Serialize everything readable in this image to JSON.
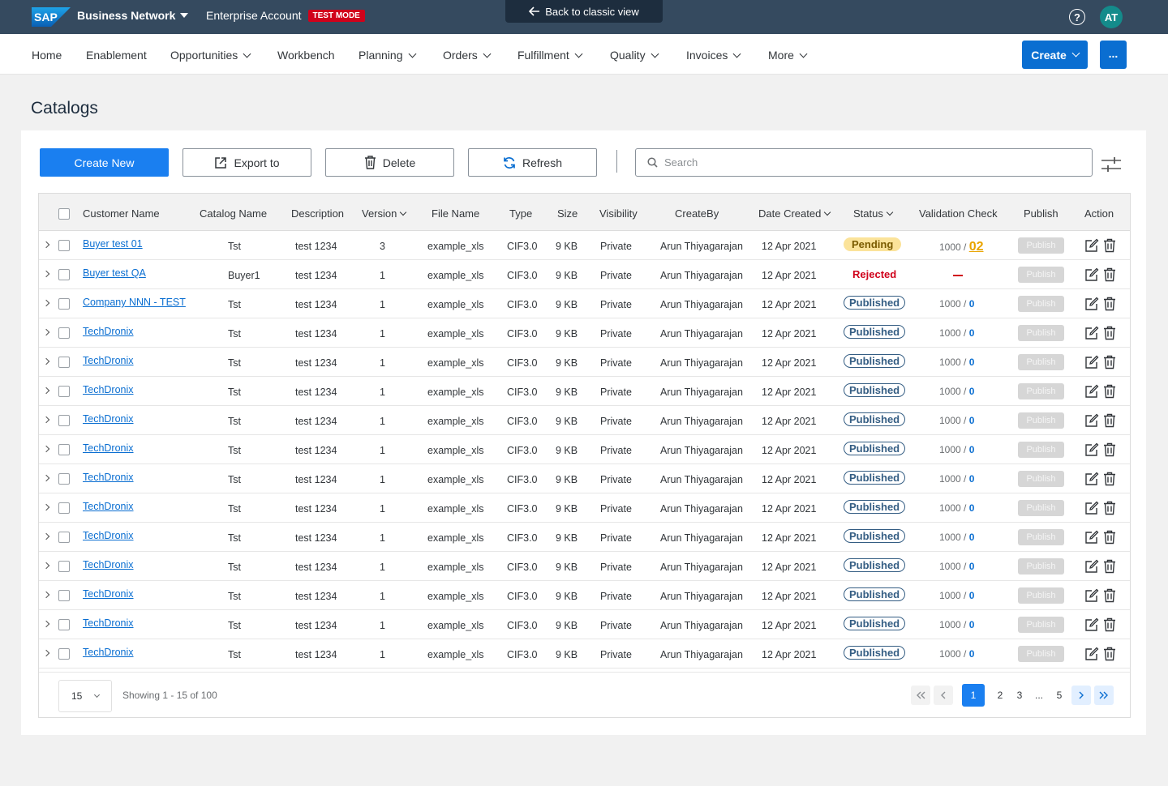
{
  "shell": {
    "logo_text": "SAP",
    "brand": "Business Network",
    "account": "Enterprise Account",
    "test_mode": "TEST MODE",
    "back_classic": "Back to classic view",
    "help": "?",
    "avatar_initials": "AT"
  },
  "nav": {
    "items": [
      {
        "label": "Home",
        "dropdown": false
      },
      {
        "label": "Enablement",
        "dropdown": false
      },
      {
        "label": "Opportunities",
        "dropdown": true
      },
      {
        "label": "Workbench",
        "dropdown": false
      },
      {
        "label": "Planning",
        "dropdown": true
      },
      {
        "label": "Orders",
        "dropdown": true
      },
      {
        "label": "Fulfillment",
        "dropdown": true
      },
      {
        "label": "Quality",
        "dropdown": true
      },
      {
        "label": "Invoices",
        "dropdown": true
      },
      {
        "label": "More",
        "dropdown": true
      }
    ],
    "create_label": "Create",
    "more_label": "..."
  },
  "page": {
    "title": "Catalogs"
  },
  "toolbar": {
    "create_new": "Create New",
    "export_to": "Export to",
    "delete": "Delete",
    "refresh": "Refresh",
    "search_placeholder": "Search"
  },
  "table": {
    "columns": {
      "customer_name": "Customer Name",
      "catalog_name": "Catalog Name",
      "description": "Description",
      "version": "Version",
      "file_name": "File Name",
      "type": "Type",
      "size": "Size",
      "visibility": "Visibility",
      "create_by": "CreateBy",
      "date_created": "Date Created",
      "status": "Status",
      "validation_check": "Validation Check",
      "publish": "Publish",
      "action": "Action"
    },
    "publish_label": "Publish",
    "rows": [
      {
        "customer": "Buyer test 01",
        "catalog": "Tst",
        "description": "test 1234",
        "version": "3",
        "file": "example_xls",
        "type": "CIF3.0",
        "size": "9 KB",
        "visibility": "Private",
        "create_by": "Arun Thiyagarajan",
        "date": "12 Apr 2021",
        "status": "Pending",
        "validation_total": "1000",
        "validation_sep": "/",
        "validation_errors": "02"
      },
      {
        "customer": "Buyer test QA",
        "catalog": "Buyer1",
        "description": "test 1234",
        "version": "1",
        "file": "example_xls",
        "type": "CIF3.0",
        "size": "9 KB",
        "visibility": "Private",
        "create_by": "Arun Thiyagarajan",
        "date": "12 Apr 2021",
        "status": "Rejected",
        "validation_total": "",
        "validation_sep": "",
        "validation_errors": ""
      },
      {
        "customer": "Company NNN - TEST",
        "catalog": "Tst",
        "description": "test 1234",
        "version": "1",
        "file": "example_xls",
        "type": "CIF3.0",
        "size": "9 KB",
        "visibility": "Private",
        "create_by": "Arun Thiyagarajan",
        "date": "12 Apr 2021",
        "status": "Published",
        "validation_total": "1000",
        "validation_sep": "/",
        "validation_errors": "0"
      },
      {
        "customer": "TechDronix",
        "catalog": "Tst",
        "description": "test 1234",
        "version": "1",
        "file": "example_xls",
        "type": "CIF3.0",
        "size": "9 KB",
        "visibility": "Private",
        "create_by": "Arun Thiyagarajan",
        "date": "12 Apr 2021",
        "status": "Published",
        "validation_total": "1000",
        "validation_sep": "/",
        "validation_errors": "0"
      },
      {
        "customer": "TechDronix",
        "catalog": "Tst",
        "description": "test 1234",
        "version": "1",
        "file": "example_xls",
        "type": "CIF3.0",
        "size": "9 KB",
        "visibility": "Private",
        "create_by": "Arun Thiyagarajan",
        "date": "12 Apr 2021",
        "status": "Published",
        "validation_total": "1000",
        "validation_sep": "/",
        "validation_errors": "0"
      },
      {
        "customer": "TechDronix",
        "catalog": "Tst",
        "description": "test 1234",
        "version": "1",
        "file": "example_xls",
        "type": "CIF3.0",
        "size": "9 KB",
        "visibility": "Private",
        "create_by": "Arun Thiyagarajan",
        "date": "12 Apr 2021",
        "status": "Published",
        "validation_total": "1000",
        "validation_sep": "/",
        "validation_errors": "0"
      },
      {
        "customer": "TechDronix",
        "catalog": "Tst",
        "description": "test 1234",
        "version": "1",
        "file": "example_xls",
        "type": "CIF3.0",
        "size": "9 KB",
        "visibility": "Private",
        "create_by": "Arun Thiyagarajan",
        "date": "12 Apr 2021",
        "status": "Published",
        "validation_total": "1000",
        "validation_sep": "/",
        "validation_errors": "0"
      },
      {
        "customer": "TechDronix",
        "catalog": "Tst",
        "description": "test 1234",
        "version": "1",
        "file": "example_xls",
        "type": "CIF3.0",
        "size": "9 KB",
        "visibility": "Private",
        "create_by": "Arun Thiyagarajan",
        "date": "12 Apr 2021",
        "status": "Published",
        "validation_total": "1000",
        "validation_sep": "/",
        "validation_errors": "0"
      },
      {
        "customer": "TechDronix",
        "catalog": "Tst",
        "description": "test 1234",
        "version": "1",
        "file": "example_xls",
        "type": "CIF3.0",
        "size": "9 KB",
        "visibility": "Private",
        "create_by": "Arun Thiyagarajan",
        "date": "12 Apr 2021",
        "status": "Published",
        "validation_total": "1000",
        "validation_sep": "/",
        "validation_errors": "0"
      },
      {
        "customer": "TechDronix",
        "catalog": "Tst",
        "description": "test 1234",
        "version": "1",
        "file": "example_xls",
        "type": "CIF3.0",
        "size": "9 KB",
        "visibility": "Private",
        "create_by": "Arun Thiyagarajan",
        "date": "12 Apr 2021",
        "status": "Published",
        "validation_total": "1000",
        "validation_sep": "/",
        "validation_errors": "0"
      },
      {
        "customer": "TechDronix",
        "catalog": "Tst",
        "description": "test 1234",
        "version": "1",
        "file": "example_xls",
        "type": "CIF3.0",
        "size": "9 KB",
        "visibility": "Private",
        "create_by": "Arun Thiyagarajan",
        "date": "12 Apr 2021",
        "status": "Published",
        "validation_total": "1000",
        "validation_sep": "/",
        "validation_errors": "0"
      },
      {
        "customer": "TechDronix",
        "catalog": "Tst",
        "description": "test 1234",
        "version": "1",
        "file": "example_xls",
        "type": "CIF3.0",
        "size": "9 KB",
        "visibility": "Private",
        "create_by": "Arun Thiyagarajan",
        "date": "12 Apr 2021",
        "status": "Published",
        "validation_total": "1000",
        "validation_sep": "/",
        "validation_errors": "0"
      },
      {
        "customer": "TechDronix",
        "catalog": "Tst",
        "description": "test 1234",
        "version": "1",
        "file": "example_xls",
        "type": "CIF3.0",
        "size": "9 KB",
        "visibility": "Private",
        "create_by": "Arun Thiyagarajan",
        "date": "12 Apr 2021",
        "status": "Published",
        "validation_total": "1000",
        "validation_sep": "/",
        "validation_errors": "0"
      },
      {
        "customer": "TechDronix",
        "catalog": "Tst",
        "description": "test 1234",
        "version": "1",
        "file": "example_xls",
        "type": "CIF3.0",
        "size": "9 KB",
        "visibility": "Private",
        "create_by": "Arun Thiyagarajan",
        "date": "12 Apr 2021",
        "status": "Published",
        "validation_total": "1000",
        "validation_sep": "/",
        "validation_errors": "0"
      },
      {
        "customer": "TechDronix",
        "catalog": "Tst",
        "description": "test 1234",
        "version": "1",
        "file": "example_xls",
        "type": "CIF3.0",
        "size": "9 KB",
        "visibility": "Private",
        "create_by": "Arun Thiyagarajan",
        "date": "12 Apr 2021",
        "status": "Published",
        "validation_total": "1000",
        "validation_sep": "/",
        "validation_errors": "0"
      }
    ]
  },
  "pagination": {
    "page_size": "15",
    "showing": "Showing 1 - 15 of 100",
    "pages": [
      "1",
      "2",
      "3",
      "...",
      "5"
    ],
    "current": "1"
  },
  "colors": {
    "shell_bg": "#354a5f",
    "primary": "#0a6ed1",
    "pending_bg": "#fbe39a",
    "rejected": "#d0021b",
    "published": "#345d83"
  }
}
